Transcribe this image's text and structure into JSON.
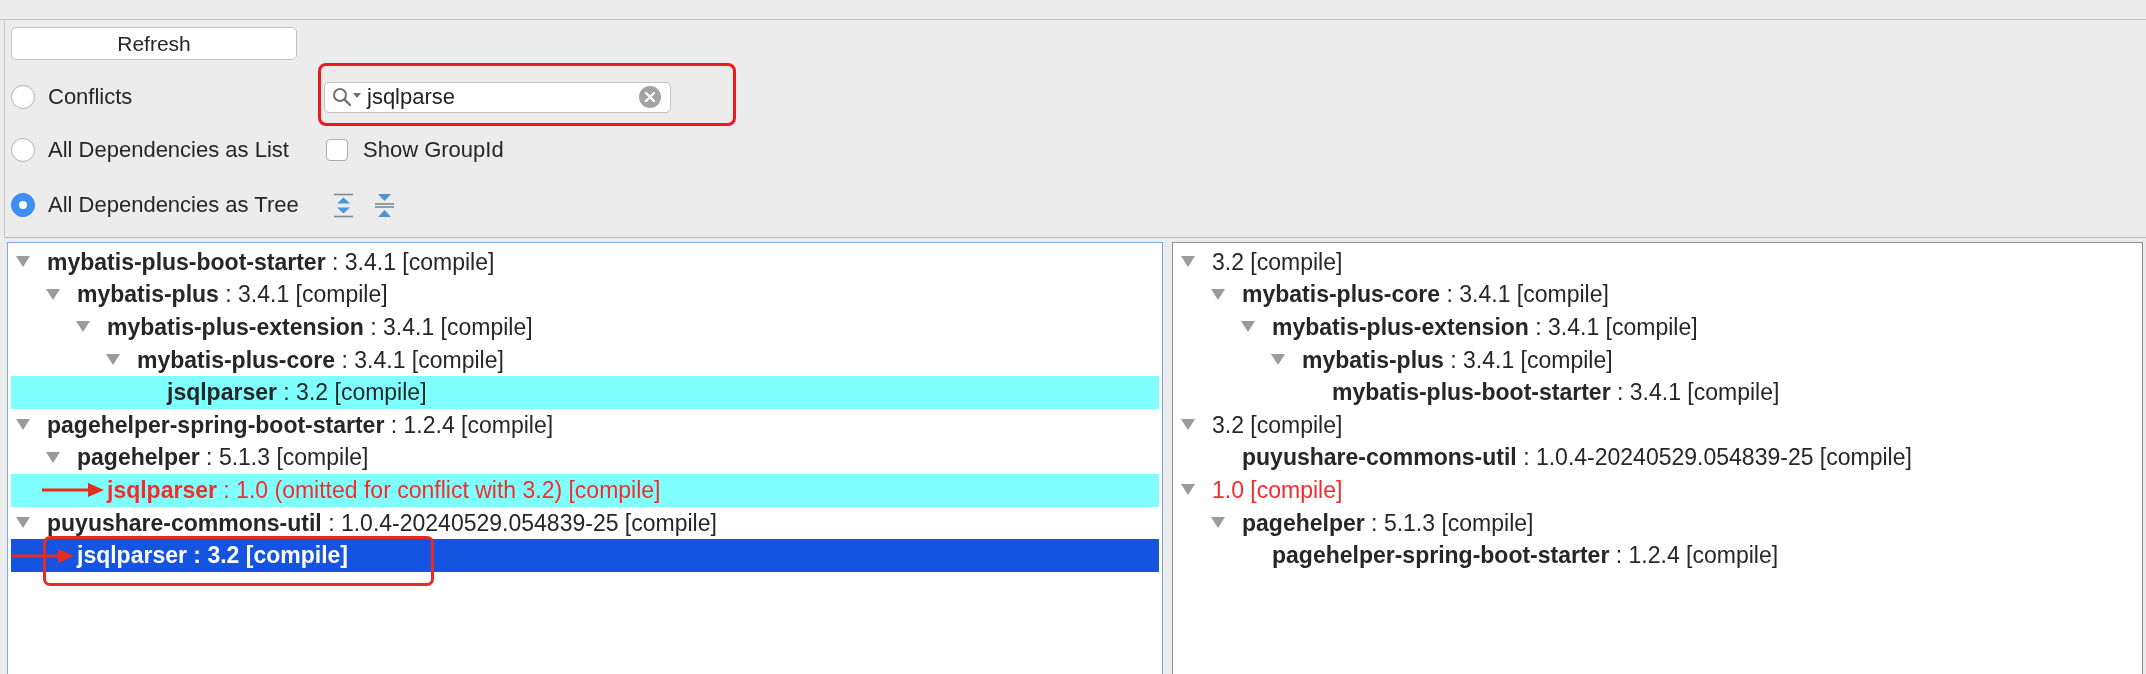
{
  "toolbar": {
    "refresh_button": "Refresh",
    "view_modes": [
      {
        "label": "Conflicts",
        "selected": false
      },
      {
        "label": "All Dependencies as List",
        "selected": false
      },
      {
        "label": "All Dependencies as Tree",
        "selected": true
      }
    ],
    "search": {
      "value": "jsqlparse",
      "boxed": true
    },
    "show_group_id": {
      "label": "Show GroupId",
      "checked": false
    }
  },
  "dependency_tree": [
    {
      "label": "**mybatis-plus-boot-starter** : 3.4.1 [compile]",
      "expanded": true,
      "selected": false,
      "match": false,
      "conflict": false,
      "children": [
        {
          "label": "**mybatis-plus** : 3.4.1 [compile]",
          "expanded": true,
          "selected": false,
          "match": false,
          "conflict": false,
          "children": [
            {
              "label": "**mybatis-plus-extension** : 3.4.1 [compile]",
              "expanded": true,
              "selected": false,
              "match": false,
              "conflict": false,
              "children": [
                {
                  "label": "**mybatis-plus-core** : 3.4.1 [compile]",
                  "expanded": true,
                  "selected": false,
                  "match": false,
                  "conflict": false,
                  "children": [
                    {
                      "label": "**jsqlparser** : 3.2 [compile]",
                      "selected": false,
                      "match": true,
                      "conflict": false
                    }
                  ]
                }
              ]
            }
          ]
        }
      ]
    },
    {
      "label": "**pagehelper-spring-boot-starter** : 1.2.4 [compile]",
      "expanded": true,
      "selected": false,
      "match": false,
      "conflict": false,
      "children": [
        {
          "label": "**pagehelper** : 5.1.3 [compile]",
          "expanded": true,
          "selected": false,
          "match": false,
          "conflict": false,
          "children": [
            {
              "label": "**jsqlparser** : 1.0 (omitted for conflict with 3.2) [compile]",
              "selected": false,
              "match": true,
              "conflict": true,
              "arrow": true
            }
          ]
        }
      ]
    },
    {
      "label": "**puyushare-commons-util** : 1.0.4-20240529.054839-25 [compile]",
      "expanded": true,
      "selected": false,
      "match": false,
      "conflict": false,
      "children": [
        {
          "label": "**jsqlparser** : 3.2 [compile]",
          "selected": true,
          "arrow": true,
          "boxed": true
        }
      ]
    }
  ],
  "usages_tree": [
    {
      "label": "3.2 [compile]",
      "expanded": true,
      "selected": false,
      "match": false,
      "conflict": false,
      "children": [
        {
          "label": "**mybatis-plus-core** : 3.4.1 [compile]",
          "expanded": true,
          "selected": false,
          "match": false,
          "conflict": false,
          "children": [
            {
              "label": "**mybatis-plus-extension** : 3.4.1 [compile]",
              "expanded": true,
              "selected": false,
              "match": false,
              "conflict": false,
              "children": [
                {
                  "label": "**mybatis-plus** : 3.4.1 [compile]",
                  "expanded": true,
                  "selected": false,
                  "match": false,
                  "conflict": false,
                  "children": [
                    {
                      "label": "**mybatis-plus-boot-starter** : 3.4.1 [compile]",
                      "selected": false,
                      "match": false,
                      "conflict": false
                    }
                  ]
                }
              ]
            }
          ]
        }
      ]
    },
    {
      "label": "3.2 [compile]",
      "expanded": true,
      "selected": false,
      "match": false,
      "conflict": false,
      "children": [
        {
          "label": "**puyushare-commons-util** : 1.0.4-20240529.054839-25 [compile]",
          "selected": false,
          "match": false,
          "conflict": false
        }
      ]
    },
    {
      "label": "1.0 [compile]",
      "expanded": true,
      "selected": false,
      "match": false,
      "conflict": true,
      "children": [
        {
          "label": "**pagehelper** : 5.1.3 [compile]",
          "expanded": true,
          "selected": false,
          "match": false,
          "conflict": false,
          "children": [
            {
              "label": "**pagehelper-spring-boot-starter** : 1.2.4 [compile]",
              "selected": false,
              "match": false,
              "conflict": false
            }
          ]
        }
      ]
    }
  ]
}
